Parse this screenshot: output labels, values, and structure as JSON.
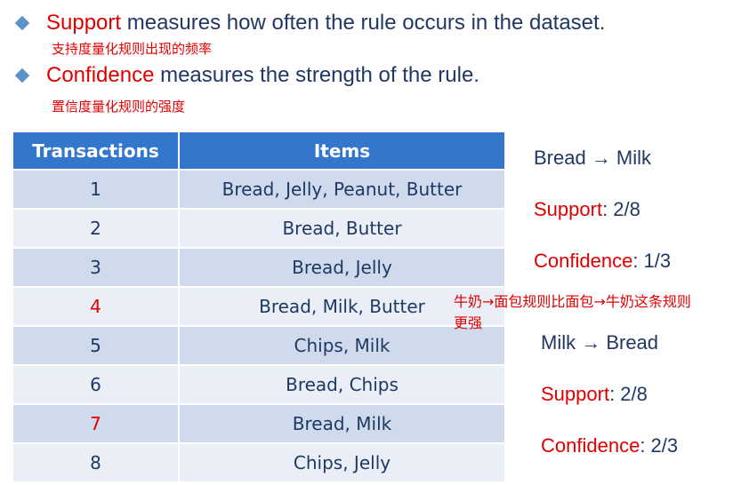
{
  "bullets": [
    {
      "term": "Support",
      "text": " measures how often the rule occurs in the dataset.",
      "note": "支持度量化规则出现的频率"
    },
    {
      "term": "Confidence",
      "text": " measures the strength of the rule.",
      "note": "置信度量化规则的强度"
    }
  ],
  "table": {
    "headers": [
      "Transactions",
      "Items"
    ],
    "rows": [
      {
        "id": "1",
        "items": "Bread, Jelly, Peanut, Butter",
        "highlight": false
      },
      {
        "id": "2",
        "items": "Bread, Butter",
        "highlight": false
      },
      {
        "id": "3",
        "items": "Bread, Jelly",
        "highlight": false
      },
      {
        "id": "4",
        "items": "Bread, Milk, Butter",
        "highlight": true
      },
      {
        "id": "5",
        "items": "Chips, Milk",
        "highlight": false
      },
      {
        "id": "6",
        "items": "Bread, Chips",
        "highlight": false
      },
      {
        "id": "7",
        "items": "Bread, Milk",
        "highlight": true
      },
      {
        "id": "8",
        "items": "Chips, Jelly",
        "highlight": false
      }
    ]
  },
  "rules": [
    {
      "title": "Bread → Milk",
      "support_label": "Support",
      "support_value": ": 2/8",
      "confidence_label": "Confidence",
      "confidence_value": ": 1/3"
    },
    {
      "title": "Milk → Bread",
      "support_label": "Support",
      "support_value": ": 2/8",
      "confidence_label": "Confidence",
      "confidence_value": ": 2/3"
    }
  ],
  "comparison_note": [
    "牛奶→面包规则比面包→牛奶这条规则",
    "更强"
  ],
  "colors": {
    "accent_red": "#e00000",
    "text_navy": "#1f3864",
    "header_blue": "#3377cc",
    "row_dark": "#cfdaed",
    "row_light": "#e9eef7"
  }
}
